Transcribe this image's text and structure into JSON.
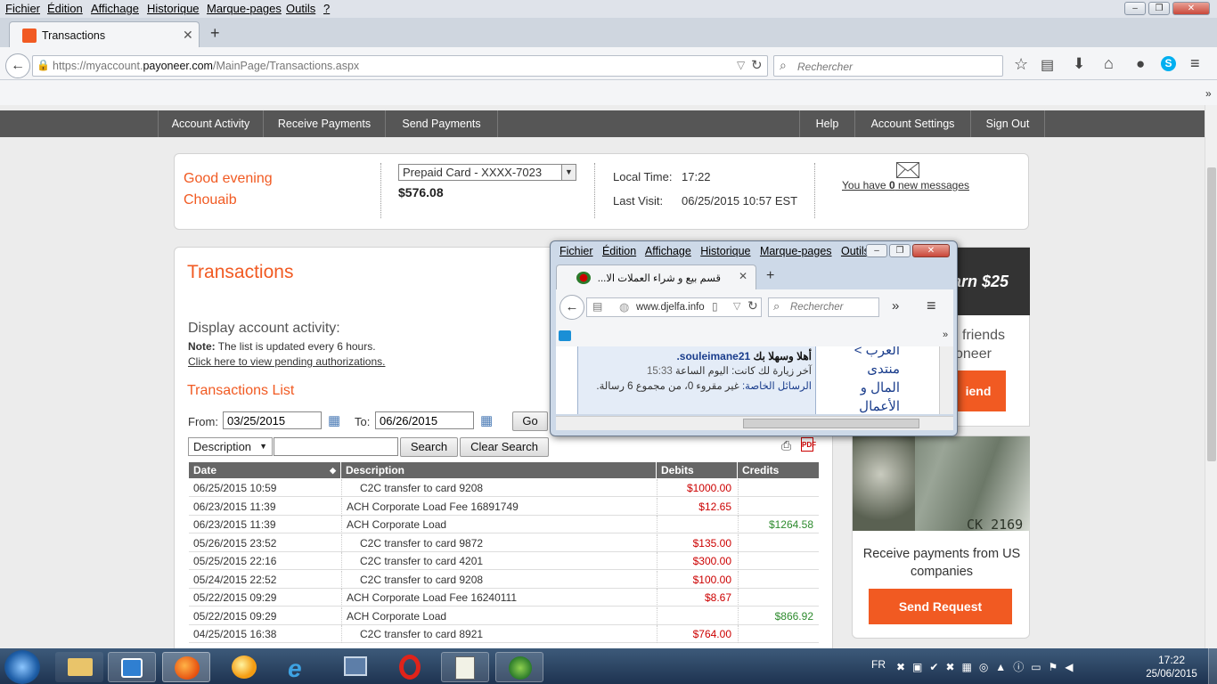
{
  "browser": {
    "menu": [
      "Fichier",
      "Édition",
      "Affichage",
      "Historique",
      "Marque-pages",
      "Outils",
      "?"
    ],
    "tab_title": "Transactions",
    "url_prefix": "https://myaccount.",
    "url_domain": "payoneer.com",
    "url_path": "/MainPage/Transactions.aspx",
    "search_placeholder": "Rechercher",
    "new_tab_symbol": "+",
    "overflow_symbol": "»"
  },
  "nav": {
    "items": [
      "Account Activity",
      "Receive Payments",
      "Send Payments",
      "Help",
      "Account Settings",
      "Sign Out"
    ]
  },
  "welcome": {
    "greeting": "Good evening",
    "name": "Chouaib",
    "card_select": "Prepaid Card - XXXX-7023",
    "balance": "$576.08",
    "local_time_label": "Local Time:",
    "local_time": "17:22",
    "last_visit_label": "Last Visit:",
    "last_visit": "06/25/2015 10:57 EST",
    "messages_prefix": "You have ",
    "messages_count": "0",
    "messages_suffix": " new messages"
  },
  "transactions": {
    "title": "Transactions",
    "display_label": "Display account activity:",
    "note_bold": "Note:",
    "note_text": " The list is updated every 6 hours.",
    "pending_link": "Click here to view pending authorizations.",
    "list_title": "Transactions List",
    "from_label": "From:",
    "from_value": "03/25/2015",
    "to_label": "To:",
    "to_value": "06/26/2015",
    "go_label": "Go",
    "filter_select": "Description",
    "search_label": "Search",
    "clear_label": "Clear Search",
    "columns": [
      "Date",
      "Description",
      "Debits",
      "Credits"
    ],
    "rows": [
      {
        "date": "06/25/2015 10:59",
        "desc": "C2C transfer to card 9208",
        "debit": "$1000.00",
        "credit": "",
        "indent": true
      },
      {
        "date": "06/23/2015 11:39",
        "desc": "ACH Corporate Load Fee 16891749",
        "debit": "$12.65",
        "credit": "",
        "indent": false
      },
      {
        "date": "06/23/2015 11:39",
        "desc": "ACH Corporate Load",
        "debit": "",
        "credit": "$1264.58",
        "indent": false
      },
      {
        "date": "05/26/2015 23:52",
        "desc": "C2C transfer to card 9872",
        "debit": "$135.00",
        "credit": "",
        "indent": true
      },
      {
        "date": "05/25/2015 22:16",
        "desc": "C2C transfer to card 4201",
        "debit": "$300.00",
        "credit": "",
        "indent": true
      },
      {
        "date": "05/24/2015 22:52",
        "desc": "C2C transfer to card 9208",
        "debit": "$100.00",
        "credit": "",
        "indent": true
      },
      {
        "date": "05/22/2015 09:29",
        "desc": "ACH Corporate Load Fee 16240111",
        "debit": "$8.67",
        "credit": "",
        "indent": false
      },
      {
        "date": "05/22/2015 09:29",
        "desc": "ACH Corporate Load",
        "debit": "",
        "credit": "$866.92",
        "indent": false
      },
      {
        "date": "04/25/2015 16:38",
        "desc": "C2C transfer to card 8921",
        "debit": "$764.00",
        "credit": "",
        "indent": true
      }
    ]
  },
  "ads": {
    "earn": "arn $25",
    "friends_line1": "friends",
    "friends_line2": "oneer",
    "friend_btn": "iend",
    "banknote_code": "CK 2169",
    "receive_text": "Receive payments from US companies",
    "send_request": "Send Request"
  },
  "popup": {
    "menu": [
      "Fichier",
      "Édition",
      "Affichage",
      "Historique",
      "Marque-pages",
      "Outils"
    ],
    "tab_title": "قسم بيع و شراء العملات الا...",
    "url": "www.djelfa.info",
    "search_placeholder": "Rechercher",
    "welcome_ar": "أهلا وسهلا بك",
    "username": "souleimane21.",
    "last_visit_ar": "آخر زيارة لك كانت: اليوم الساعة",
    "last_visit_time": "15:33",
    "pm_label": "الرسائل الخاصة:",
    "pm_text": "غير مقروء 0، من مجموع 6 رسالة.",
    "side_links": [
      "العرب >",
      "منتدى",
      "المال و",
      "الأعمال"
    ]
  },
  "taskbar": {
    "lang": "FR",
    "time": "17:22",
    "date": "25/06/2015"
  },
  "colors": {
    "brand_orange": "#f15a22",
    "nav_gray": "#565656",
    "debit_red": "#cc0000",
    "credit_green": "#2e8b2e"
  }
}
